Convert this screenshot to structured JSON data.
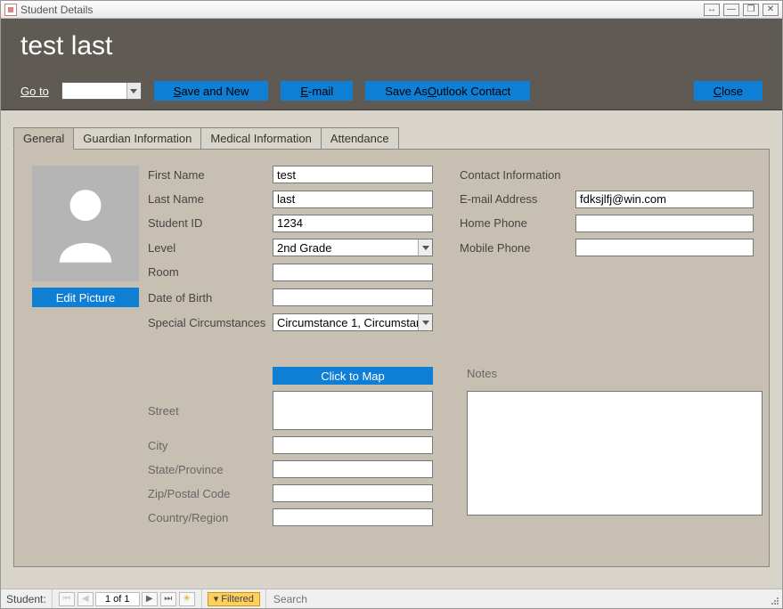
{
  "window": {
    "title": "Student Details"
  },
  "header": {
    "title": "test last"
  },
  "toolbar": {
    "goto_label": "Go to",
    "save_and_new": {
      "pre": "",
      "u": "S",
      "post": "ave and New"
    },
    "email": {
      "pre": "",
      "u": "E",
      "post": "-mail"
    },
    "save_outlook": {
      "pre": "Save As ",
      "u": "O",
      "post": "utlook Contact"
    },
    "close": {
      "pre": "",
      "u": "C",
      "post": "lose"
    }
  },
  "tabs": [
    "General",
    "Guardian Information",
    "Medical Information",
    "Attendance"
  ],
  "general": {
    "edit_picture_label": "Edit Picture",
    "labels": {
      "first_name": "First Name",
      "last_name": "Last Name",
      "student_id": "Student ID",
      "level": "Level",
      "room": "Room",
      "date_of_birth": "Date of Birth",
      "special": "Special Circumstances",
      "contact_info": "Contact Information",
      "email": "E-mail Address",
      "home_phone": "Home Phone",
      "mobile_phone": "Mobile Phone",
      "click_to_map": "Click to Map",
      "street": "Street",
      "city": "City",
      "state": "State/Province",
      "zip": "Zip/Postal Code",
      "country": "Country/Region",
      "notes": "Notes"
    },
    "values": {
      "first_name": "test",
      "last_name": "last",
      "student_id": "1234",
      "level": "2nd Grade",
      "room": "",
      "date_of_birth": "",
      "special": "Circumstance 1, Circumstan",
      "email": "fdksjlfj@win.com",
      "home_phone": "",
      "mobile_phone": "",
      "street": "",
      "city": "",
      "state": "",
      "zip": "",
      "country": "",
      "notes": ""
    }
  },
  "status": {
    "record_label": "Student:",
    "position": "1 of 1",
    "filtered_label": "Filtered",
    "search_placeholder": "Search"
  },
  "colors": {
    "accent": "#0f7fd6",
    "chrome": "#5f5a53",
    "panel": "#c7c0b2"
  }
}
